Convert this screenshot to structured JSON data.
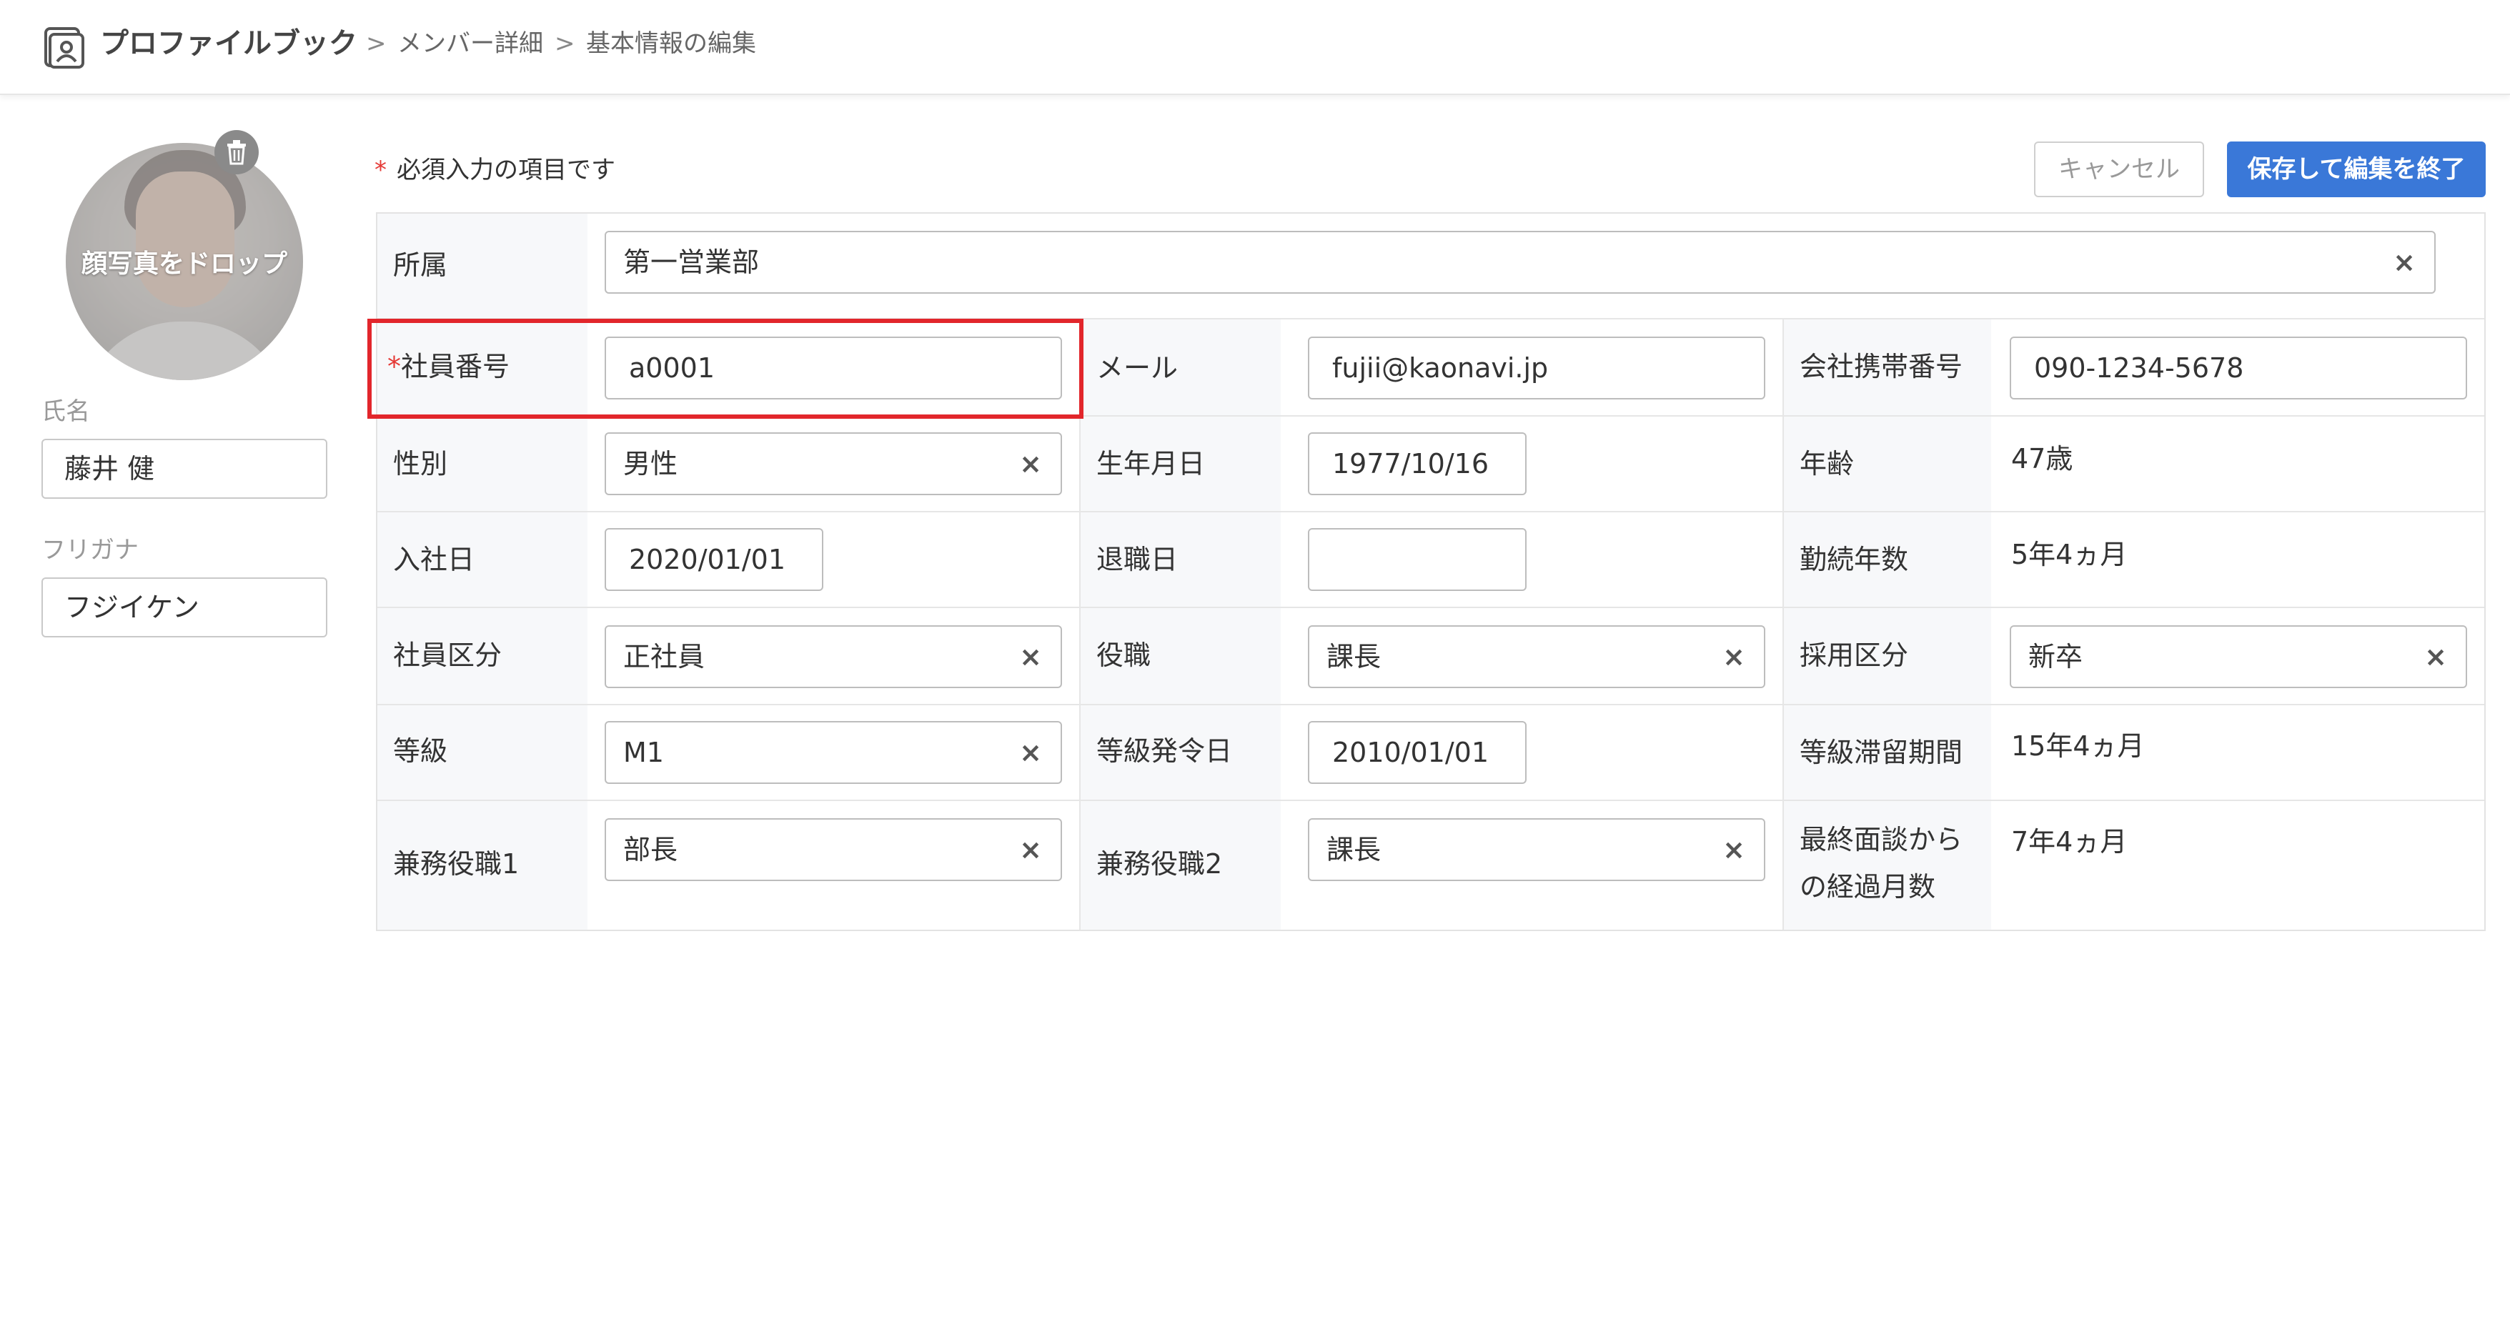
{
  "breadcrumb": {
    "app": "プロファイルブック",
    "sep": ">",
    "item1": "メンバー詳細",
    "item2": "基本情報の編集"
  },
  "icons": {
    "app": "profile-book-icon",
    "trash": "trash-icon",
    "clear": "clear-x-icon",
    "chevron": "chevron-right-icon"
  },
  "avatar": {
    "drop_text": "顔写真をドロップ"
  },
  "sidebar": {
    "name_label": "氏名",
    "name_value": "藤井 健",
    "kana_label": "フリガナ",
    "kana_value": "フジイケン"
  },
  "required_note": {
    "star": "*",
    "text": "必須入力の項目です"
  },
  "buttons": {
    "cancel": "キャンセル",
    "save": "保存して編集を終了"
  },
  "colors": {
    "accent": "#3a78d8",
    "highlight": "#e2262b",
    "required": "#e53935"
  },
  "form": {
    "clear": "×",
    "affiliation": {
      "label": "所属",
      "value": "第一営業部"
    },
    "employee_no": {
      "star": "*",
      "label": "社員番号",
      "value": "a0001"
    },
    "email": {
      "label": "メール",
      "value": "fujii@kaonavi.jp"
    },
    "mobile": {
      "label": "会社携帯番号",
      "value": "090-1234-5678"
    },
    "gender": {
      "label": "性別",
      "value": "男性"
    },
    "birthday": {
      "label": "生年月日",
      "value": "1977/10/16"
    },
    "age": {
      "label": "年齢",
      "value": "47歳"
    },
    "hire_date": {
      "label": "入社日",
      "value": "2020/01/01"
    },
    "retire_date": {
      "label": "退職日",
      "value": ""
    },
    "tenure": {
      "label": "勤続年数",
      "value": "5年4ヵ月"
    },
    "employee_type": {
      "label": "社員区分",
      "value": "正社員"
    },
    "position": {
      "label": "役職",
      "value": "課長"
    },
    "hiring_type": {
      "label": "採用区分",
      "value": "新卒"
    },
    "grade": {
      "label": "等級",
      "value": "M1"
    },
    "grade_date": {
      "label": "等級発令日",
      "value": "2010/01/01"
    },
    "grade_period": {
      "label": "等級滞留期間",
      "value": "15年4ヵ月"
    },
    "concurrent1": {
      "label": "兼務役職1",
      "value": "部長"
    },
    "concurrent2": {
      "label": "兼務役職2",
      "value": "課長"
    },
    "last_interview": {
      "label_line1": "最終面談から",
      "label_line2": "の経過月数",
      "value": "7年4ヵ月"
    }
  }
}
